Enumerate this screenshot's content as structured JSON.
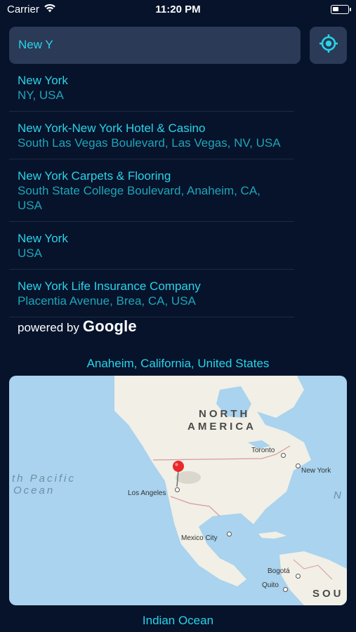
{
  "status": {
    "carrier": "Carrier",
    "time": "11:20 PM",
    "battery_level": 0.4
  },
  "search": {
    "value": "New Y",
    "locate_icon": "target-location-icon"
  },
  "results": [
    {
      "title": "New York",
      "subtitle": "NY, USA"
    },
    {
      "title": "New York-New York Hotel & Casino",
      "subtitle": "South Las Vegas Boulevard, Las Vegas, NV, USA"
    },
    {
      "title": "New York Carpets & Flooring",
      "subtitle": "South State College Boulevard, Anaheim, CA, USA"
    },
    {
      "title": "New York",
      "subtitle": "USA"
    },
    {
      "title": "New York Life Insurance Company",
      "subtitle": "Placentia Avenue, Brea, CA, USA"
    }
  ],
  "attribution": {
    "prefix": "powered by",
    "brand": "Google"
  },
  "current_location": "Anaheim, California, United States",
  "map": {
    "region_north_1": "NORTH",
    "region_north_2": "AMERICA",
    "ocean_1": "th Pacific",
    "ocean_2": "Ocean",
    "ocean_right": "N",
    "region_south": "SOU",
    "cities": {
      "toronto": "Toronto",
      "new_york": "New York",
      "los_angeles": "Los Angeles",
      "mexico_city": "Mexico City",
      "bogota": "Bogotá",
      "quito": "Quito"
    },
    "colors": {
      "water": "#a9d3ee",
      "land": "#f1efe6",
      "pin": "#e8282b"
    }
  },
  "bottom_label": "Indian Ocean"
}
